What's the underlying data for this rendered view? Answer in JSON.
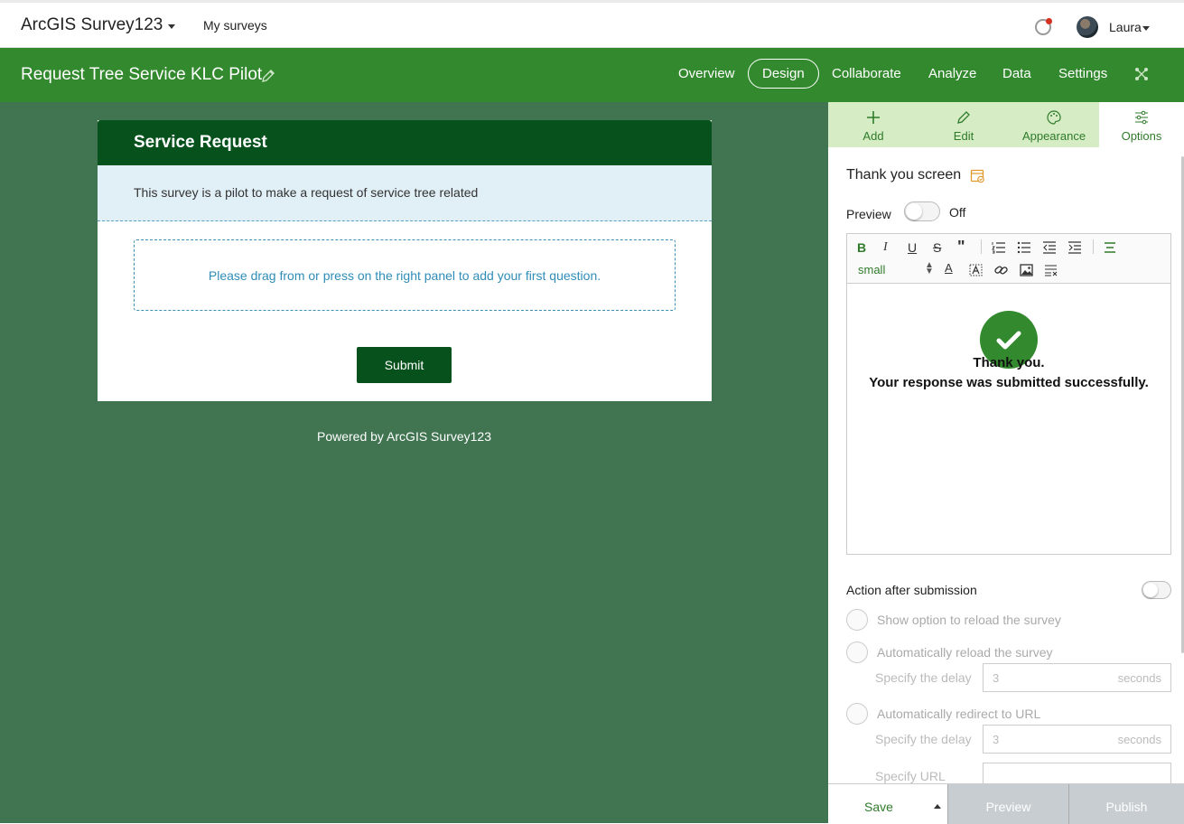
{
  "header": {
    "app_title": "ArcGIS Survey123",
    "my_surveys": "My surveys",
    "user_name": "Laura"
  },
  "survey_bar": {
    "title": "Request Tree Service KLC Pilot",
    "nav": [
      "Overview",
      "Design",
      "Collaborate",
      "Analyze",
      "Data",
      "Settings"
    ],
    "active_nav": "Design"
  },
  "form": {
    "title": "Service Request",
    "description": "This survey is a pilot to make a request of service tree related",
    "dropzone_hint": "Please drag from or press on the right panel to add your first question.",
    "submit_label": "Submit",
    "powered_by": "Powered by ArcGIS Survey123"
  },
  "panel": {
    "tabs": [
      {
        "label": "Add",
        "icon": "plus-icon"
      },
      {
        "label": "Edit",
        "icon": "pencil-icon"
      },
      {
        "label": "Appearance",
        "icon": "palette-icon"
      },
      {
        "label": "Options",
        "icon": "sliders-icon"
      }
    ],
    "active_tab": "Options",
    "section_title": "Thank you screen",
    "preview_label": "Preview",
    "preview_state": "Off",
    "editor": {
      "font_size": "small",
      "thanks_line1": "Thank you.",
      "thanks_line2": "Your response was submitted successfully."
    },
    "action_after_submission": "Action after submission",
    "options": [
      {
        "label": "Show option to reload the survey"
      },
      {
        "label": "Automatically reload the survey",
        "delay_label": "Specify the delay",
        "delay_value": "3",
        "unit": "seconds"
      },
      {
        "label": "Automatically redirect to URL",
        "delay_label": "Specify the delay",
        "delay_value": "3",
        "unit": "seconds",
        "url_label": "Specify URL"
      }
    ],
    "bottom": {
      "save": "Save",
      "preview": "Preview",
      "publish": "Publish"
    }
  },
  "colors": {
    "brand_green": "#338a2e",
    "dark_green": "#07521c",
    "canvas_green": "#417552",
    "tab_bg": "#d5ecc5"
  }
}
